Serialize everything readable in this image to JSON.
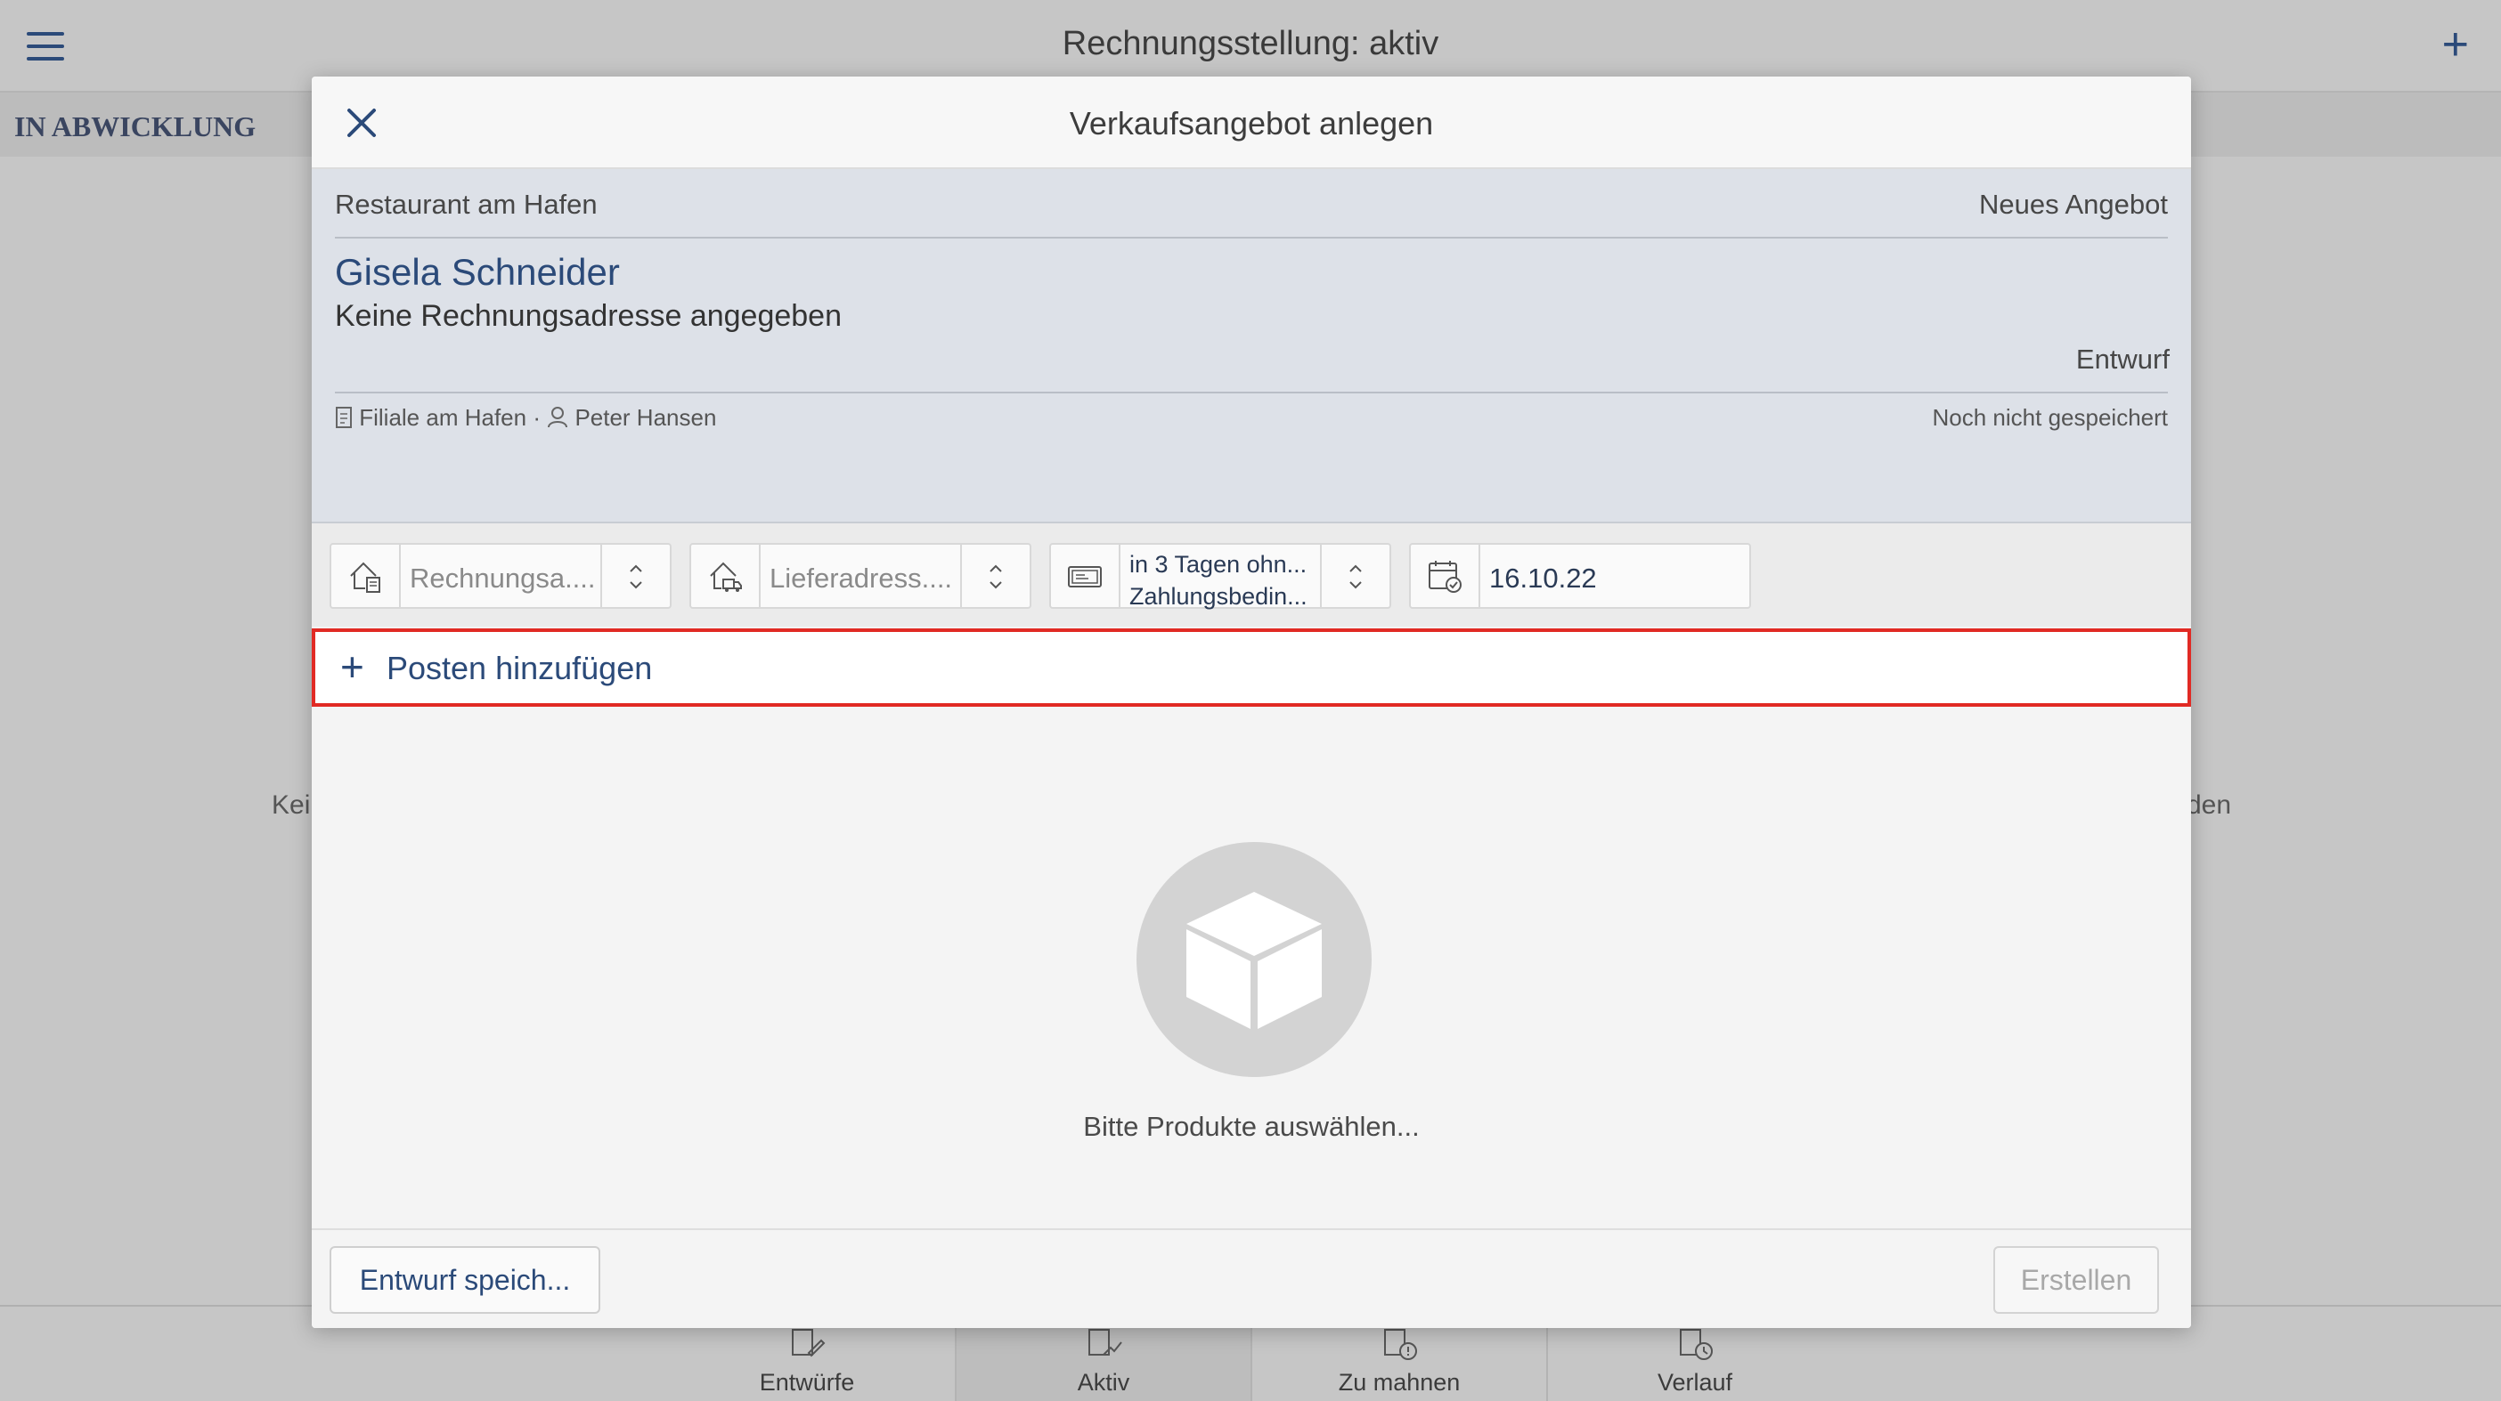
{
  "app": {
    "title": "Rechnungsstellung: aktiv",
    "section": "IN ABWICKLUNG",
    "background_empty_left": "Kei",
    "background_empty_right": "den",
    "tabs": [
      {
        "label": "Entwürfe",
        "icon": "draft-invoice-icon",
        "active": false
      },
      {
        "label": "Aktiv",
        "icon": "active-invoice-icon",
        "active": true
      },
      {
        "label": "Zu mahnen",
        "icon": "reminder-invoice-icon",
        "active": false
      },
      {
        "label": "Verlauf",
        "icon": "history-invoice-icon",
        "active": false
      }
    ]
  },
  "modal": {
    "title": "Verkaufsangebot anlegen",
    "shop": "Restaurant am Hafen",
    "offer_type": "Neues Angebot",
    "customer": "Gisela Schneider",
    "address_note": "Keine Rechnungsadresse angegeben",
    "status": "Entwurf",
    "branch": "Filiale am Hafen",
    "separator": " · ",
    "employee": "Peter Hansen",
    "save_state": "Noch nicht gespeichert",
    "fields": {
      "billing_address": "Rechnungsa....",
      "delivery_address": "Lieferadress....",
      "payment_line1": "in 3 Tagen ohn...",
      "payment_line2": "Zahlungsbedin...",
      "date": "16.10.22"
    },
    "add_item": "Posten hinzufügen",
    "empty_text": "Bitte Produkte auswählen...",
    "save_draft": "Entwurf speich...",
    "create": "Erstellen"
  },
  "colors": {
    "accent": "#2b4a79",
    "highlight": "#e12a24",
    "panel": "#dde1e8"
  }
}
